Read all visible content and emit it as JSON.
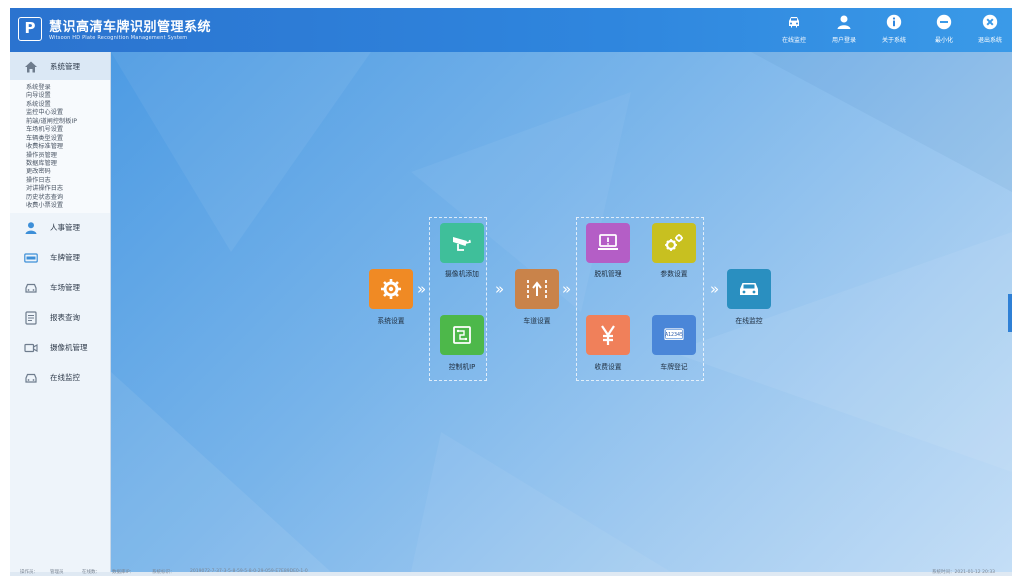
{
  "header": {
    "logo": "P",
    "title": "慧识高清车牌识别管理系统",
    "subtitle": "Witsoon HD Plate Recognition Management System",
    "buttons": [
      {
        "label": "在线监控",
        "icon": "car-icon"
      },
      {
        "label": "用户登录",
        "icon": "user-icon"
      },
      {
        "label": "关于系统",
        "icon": "info-icon"
      },
      {
        "label": "最小化",
        "icon": "minimize-icon"
      },
      {
        "label": "退出系统",
        "icon": "close-icon"
      }
    ]
  },
  "sidebar": {
    "system_label": "系统管理",
    "sub_items": [
      "系统登录",
      "向导设置",
      "系统设置",
      "监控中心设置",
      "前端/道闸控制板IP",
      "车场机号设置",
      "车辆类型设置",
      "收费标准管理",
      "操作员管理",
      "数据库管理",
      "更改密码",
      "操作日志",
      "对讲操作日志",
      "历史状态查询",
      "收费小票设置"
    ],
    "sections": [
      {
        "label": "人事管理",
        "icon": "person-icon"
      },
      {
        "label": "车牌管理",
        "icon": "license-plate-icon"
      },
      {
        "label": "车场管理",
        "icon": "parking-car-icon"
      },
      {
        "label": "报表查询",
        "icon": "report-icon"
      },
      {
        "label": "摄像机管理",
        "icon": "camera-icon"
      },
      {
        "label": "在线监控",
        "icon": "monitor-car-icon"
      }
    ]
  },
  "flow": {
    "system_settings": "系统设置",
    "camera_add": "摄像机添加",
    "controller_ip": "控制机IP",
    "lane_settings": "车道设置",
    "offline_mgmt": "脱机管理",
    "param_settings": "参数设置",
    "fee_settings": "收费设置",
    "plate_register": "车牌登记",
    "plate_sample": "A12345",
    "online_monitor": "在线监控"
  },
  "status": {
    "s1": "操作员：",
    "s2": "管理员",
    "s3": "在线数：",
    "s4": "数据库IP：",
    "s5": "系统标识：",
    "s6": "2019072-7-37-3-5-8-59-5-8-0-29-059-E7E89DE0-1-0",
    "s7": "系统时间：2021-01-12 20:33"
  },
  "colors": {
    "header": "#2b73cf",
    "orange": "#f08a24",
    "green_teal": "#3fbf9a",
    "green": "#4db84a",
    "brown": "#c9834a",
    "purple": "#b45ec6",
    "yellow": "#c8c020",
    "salmon": "#f0805a",
    "blue": "#4a86d8",
    "teal_blue": "#2a8fc0"
  }
}
